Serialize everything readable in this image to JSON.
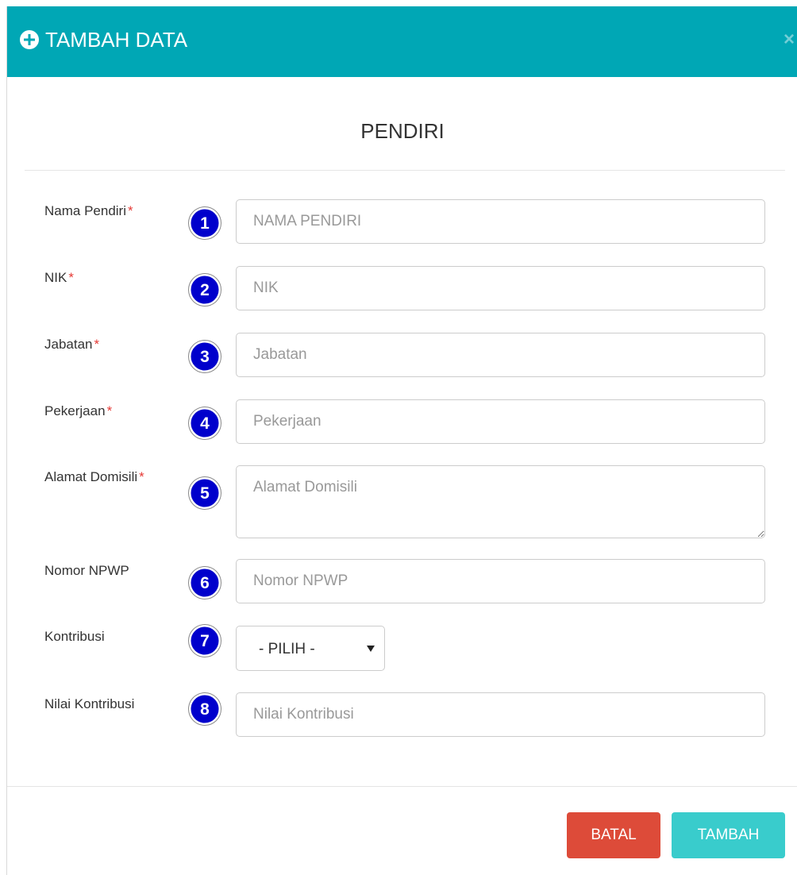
{
  "header": {
    "title": "TAMBAH DATA",
    "close_label": "×",
    "background_color": "#00a7b5"
  },
  "section_title": "PENDIRI",
  "required_mark": "*",
  "fields": [
    {
      "number": "1",
      "label": "Nama Pendiri",
      "required": true,
      "placeholder": "NAMA PENDIRI"
    },
    {
      "number": "2",
      "label": "NIK",
      "required": true,
      "placeholder": "NIK"
    },
    {
      "number": "3",
      "label": "Jabatan",
      "required": true,
      "placeholder": "Jabatan"
    },
    {
      "number": "4",
      "label": "Pekerjaan",
      "required": true,
      "placeholder": "Pekerjaan"
    },
    {
      "number": "5",
      "label": "Alamat Domisili",
      "required": true,
      "placeholder": "Alamat Domisili"
    },
    {
      "number": "6",
      "label": "Nomor NPWP",
      "required": false,
      "placeholder": "Nomor NPWP"
    },
    {
      "number": "7",
      "label": "Kontribusi",
      "required": false,
      "selected": "- PILIH -"
    },
    {
      "number": "8",
      "label": "Nilai Kontribusi",
      "required": false,
      "placeholder": "Nilai Kontribusi"
    }
  ],
  "buttons": {
    "cancel_label": "BATAL",
    "submit_label": "TAMBAH",
    "cancel_color": "#dd4b39",
    "submit_color": "#39cccc"
  },
  "colors": {
    "badge_fill": "#0000cc",
    "required_mark": "#e53935"
  },
  "icons": {
    "header": "plus-circle-icon",
    "close": "close-icon",
    "select": "chevron-down-icon",
    "badge": "number-badge-icon"
  }
}
